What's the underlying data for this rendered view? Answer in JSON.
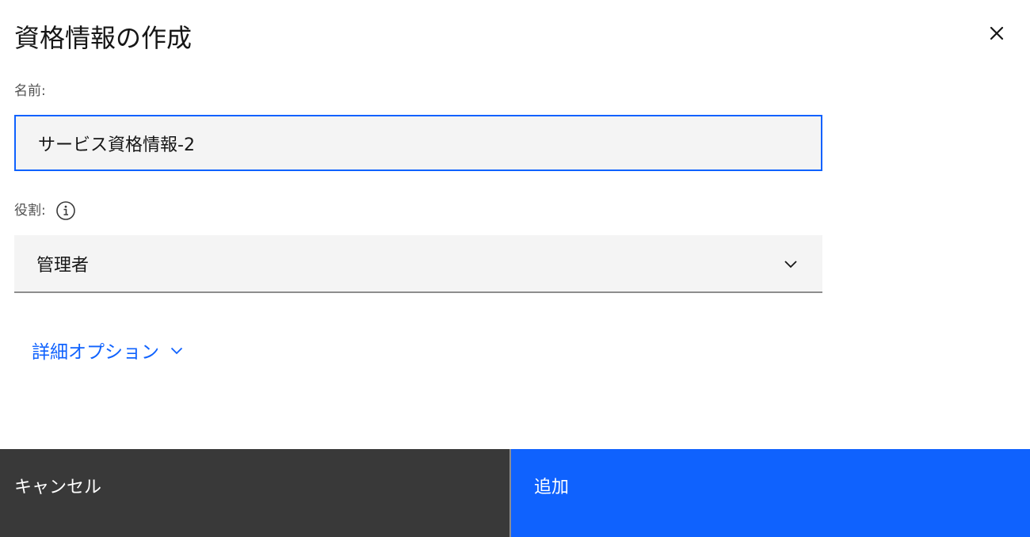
{
  "dialog": {
    "title": "資格情報の作成",
    "close_icon": "close-icon"
  },
  "form": {
    "name_label": "名前:",
    "name_value": "サービス資格情報-2",
    "role_label": "役割:",
    "role_info_icon": "info-icon",
    "role_selected": "管理者",
    "advanced_options_label": "詳細オプション"
  },
  "footer": {
    "cancel_label": "キャンセル",
    "add_label": "追加"
  },
  "colors": {
    "primary": "#0f62fe",
    "cancel_bg": "#393939",
    "field_bg": "#f4f4f4"
  }
}
